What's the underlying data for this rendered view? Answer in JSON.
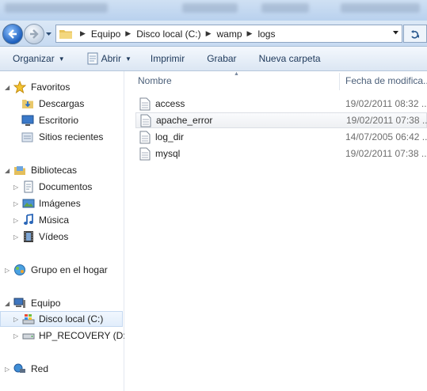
{
  "address": {
    "crumbs": [
      "Equipo",
      "Disco local (C:)",
      "wamp",
      "logs"
    ]
  },
  "toolbar": {
    "organize": "Organizar",
    "open": "Abrir",
    "print": "Imprimir",
    "burn": "Grabar",
    "new_folder": "Nueva carpeta"
  },
  "nav": {
    "favorites": "Favoritos",
    "downloads": "Descargas",
    "desktop": "Escritorio",
    "recent": "Sitios recientes",
    "libraries": "Bibliotecas",
    "documents": "Documentos",
    "pictures": "Imágenes",
    "music": "Música",
    "videos": "Vídeos",
    "homegroup": "Grupo en el hogar",
    "computer": "Equipo",
    "local_disk": "Disco local (C:)",
    "recovery": "HP_RECOVERY (D:)",
    "network": "Red"
  },
  "columns": {
    "name": "Nombre",
    "modified": "Fecha de modifica..."
  },
  "files": [
    {
      "name": "access",
      "date": "19/02/2011 08:32 ..."
    },
    {
      "name": "apache_error",
      "date": "19/02/2011 07:38 ..."
    },
    {
      "name": "log_dir",
      "date": "14/07/2005 06:42 ..."
    },
    {
      "name": "mysql",
      "date": "19/02/2011 07:38 ..."
    }
  ],
  "icons": {
    "back": "back-arrow-icon",
    "forward": "forward-arrow-icon",
    "refresh": "refresh-icon",
    "file": "text-file-icon"
  }
}
